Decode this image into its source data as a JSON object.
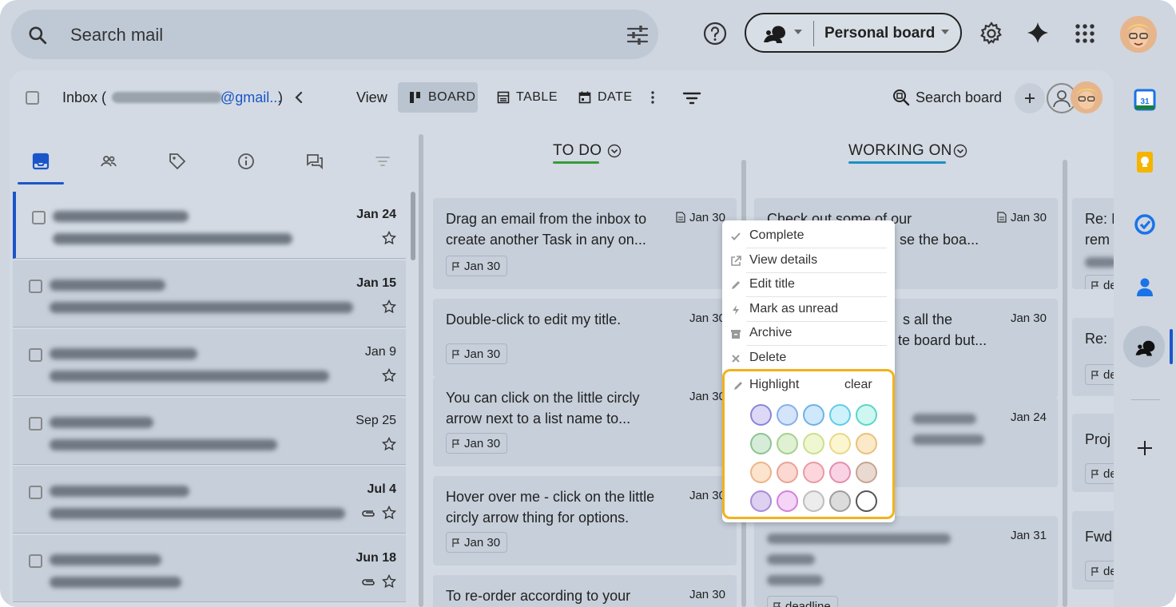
{
  "search": {
    "placeholder": "Search mail"
  },
  "header": {
    "board_name": "Personal board"
  },
  "toolbar": {
    "inbox_label": "Inbox (",
    "account_suffix": "@gmail...",
    "close_paren": ")",
    "view_label": "View",
    "views": [
      {
        "label": "BOARD",
        "active": true
      },
      {
        "label": "TABLE",
        "active": false
      },
      {
        "label": "DATE",
        "active": false
      }
    ],
    "search_board_label": "Search board"
  },
  "emails": [
    {
      "date": "Jan 24",
      "bold": true,
      "attachment": false
    },
    {
      "date": "Jan 15",
      "bold": true,
      "attachment": false
    },
    {
      "date": "Jan 9",
      "bold": false,
      "attachment": false
    },
    {
      "date": "Sep 25",
      "bold": false,
      "attachment": false
    },
    {
      "date": "Jul 4",
      "bold": true,
      "attachment": true
    },
    {
      "date": "Jun 18",
      "bold": true,
      "attachment": true
    }
  ],
  "columns": [
    {
      "name": "TO DO",
      "underline_color": "#3a9a3a",
      "cards": [
        {
          "title": "Drag an email from the inbox to create another Task in any on...",
          "date": "Jan 30",
          "flag": "Jan 30"
        },
        {
          "title": "Double-click to edit my title.",
          "date": "Jan 30",
          "flag": "Jan 30"
        },
        {
          "title": "You can click on the little circly arrow next to a list name to...",
          "date": "Jan 30",
          "flag": "Jan 30"
        },
        {
          "title": "Hover over me - click on the little circly arrow thing for options.",
          "date": "Jan 30",
          "flag": "Jan 30"
        },
        {
          "title": "To re-order according to your",
          "date": "Jan 30"
        }
      ]
    },
    {
      "name": "WORKING ON",
      "underline_color": "#1c8fc4",
      "cards": [
        {
          "title": "Check out some of our",
          "title2": "se the boa...",
          "date": "Jan 30"
        },
        {
          "title": "s all the",
          "title2": "te board but...",
          "date": "Jan 30"
        },
        {
          "date": "Jan 24"
        },
        {
          "date": "Jan 31",
          "flag": "deadline"
        }
      ]
    },
    {
      "cards": [
        {
          "title": "Re: I",
          "title2": "rem",
          "flag": "de"
        },
        {
          "title": "Re: ",
          "flag": "de"
        },
        {
          "title": "Proj",
          "flag": "de"
        },
        {
          "title": "Fwd",
          "flag": "de"
        }
      ]
    }
  ],
  "context_menu": {
    "items": [
      {
        "label": "Complete",
        "icon": "check-icon"
      },
      {
        "label": "View details",
        "icon": "open-external-icon"
      },
      {
        "label": "Edit title",
        "icon": "pencil-icon"
      },
      {
        "label": "Mark as unread",
        "icon": "bolt-icon"
      },
      {
        "label": "Archive",
        "icon": "archive-icon"
      },
      {
        "label": "Delete",
        "icon": "x-icon"
      }
    ],
    "highlight_label": "Highlight",
    "clear_label": "clear",
    "swatches": [
      [
        "#dcd8f6",
        "#d4e4fb",
        "#cfe8fb",
        "#cdf2fb",
        "#cdf7f0"
      ],
      [
        "#d6ecd9",
        "#dff0d3",
        "#eef6d2",
        "#fbf6cf",
        "#fbe9c9"
      ],
      [
        "#fce3cd",
        "#fbd9d2",
        "#fcd6dc",
        "#f9d3e3",
        "#ead9d1"
      ],
      [
        "#ddd0f1",
        "#f4d5f6",
        "#ececec",
        "#dcdcdc",
        "#ffffff"
      ]
    ],
    "swatch_borders": [
      [
        "#8a86d8",
        "#86b0ea",
        "#6db2e6",
        "#62cbe8",
        "#5ad6c7"
      ],
      [
        "#8cc490",
        "#a6d08e",
        "#cbe08a",
        "#ead78a",
        "#e8c17c"
      ],
      [
        "#ecb488",
        "#e8a395",
        "#e99aa5",
        "#e38ead",
        "#c4a595"
      ],
      [
        "#a98ad8",
        "#d47fdc",
        "#bdbdbd",
        "#9e9e9e",
        "#555555"
      ]
    ]
  },
  "colors": {
    "accent": "#1a56c9",
    "highlight_outline": "#f2b21c"
  }
}
